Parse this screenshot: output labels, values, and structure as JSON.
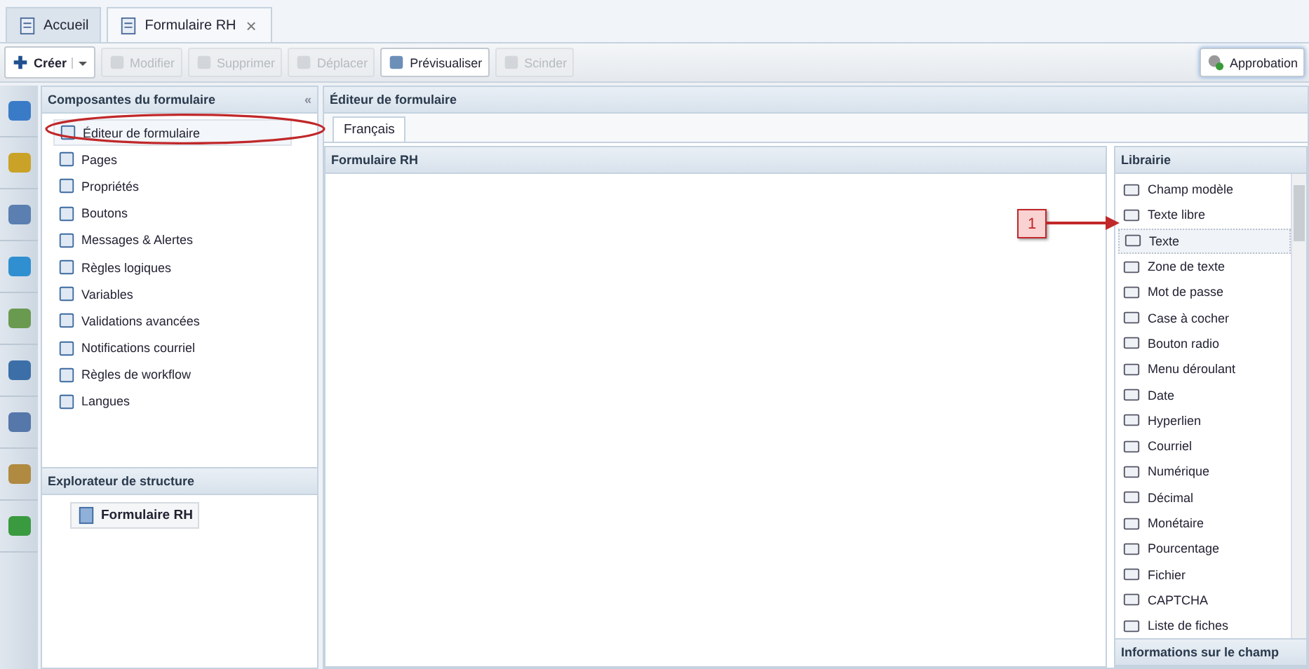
{
  "tabs": [
    {
      "label": "Accueil",
      "selected": false,
      "closable": false
    },
    {
      "label": "Formulaire RH",
      "selected": true,
      "closable": true
    }
  ],
  "close_glyph": "×",
  "toolbar": [
    {
      "label": "Créer",
      "disabled": false,
      "kind": "split"
    },
    {
      "label": "Modifier",
      "disabled": true,
      "kind": "button"
    },
    {
      "label": "Supprimer",
      "disabled": true,
      "kind": "button"
    },
    {
      "label": "Déplacer",
      "disabled": true,
      "kind": "button"
    },
    {
      "label": "Prévisualiser",
      "disabled": false,
      "kind": "button"
    },
    {
      "label": "Scinder",
      "disabled": true,
      "kind": "button"
    }
  ],
  "approval_button": "Approbation",
  "components_panel": {
    "title": "Composantes du formulaire",
    "collapse_glyph": "«",
    "items": [
      {
        "label": "Éditeur de formulaire",
        "selected": true
      },
      {
        "label": "Pages",
        "selected": false
      },
      {
        "label": "Propriétés",
        "selected": false
      },
      {
        "label": "Boutons",
        "selected": false
      },
      {
        "label": "Messages & Alertes",
        "selected": false
      },
      {
        "label": "Règles logiques",
        "selected": false
      },
      {
        "label": "Variables",
        "selected": false
      },
      {
        "label": "Validations avancées",
        "selected": false
      },
      {
        "label": "Notifications courriel",
        "selected": false
      },
      {
        "label": "Règles de workflow",
        "selected": false
      },
      {
        "label": "Langues",
        "selected": false
      }
    ]
  },
  "structure_panel": {
    "title": "Explorateur de structure",
    "items": [
      {
        "label": "Formulaire RH"
      }
    ]
  },
  "editor": {
    "title": "Éditeur de formulaire",
    "language_tabs": [
      {
        "label": "Français",
        "selected": true
      }
    ],
    "form_title": "Formulaire RH"
  },
  "library": {
    "title": "Librairie",
    "items": [
      {
        "label": "Champ modèle",
        "selected": false
      },
      {
        "label": "Texte libre",
        "selected": false
      },
      {
        "label": "Texte",
        "selected": true
      },
      {
        "label": "Zone de texte",
        "selected": false
      },
      {
        "label": "Mot de passe",
        "selected": false
      },
      {
        "label": "Case à cocher",
        "selected": false
      },
      {
        "label": "Bouton radio",
        "selected": false
      },
      {
        "label": "Menu déroulant",
        "selected": false
      },
      {
        "label": "Date",
        "selected": false
      },
      {
        "label": "Hyperlien",
        "selected": false
      },
      {
        "label": "Courriel",
        "selected": false
      },
      {
        "label": "Numérique",
        "selected": false
      },
      {
        "label": "Décimal",
        "selected": false
      },
      {
        "label": "Monétaire",
        "selected": false
      },
      {
        "label": "Pourcentage",
        "selected": false
      },
      {
        "label": "Fichier",
        "selected": false
      },
      {
        "label": "CAPTCHA",
        "selected": false
      },
      {
        "label": "Liste de fiches",
        "selected": false
      }
    ]
  },
  "field_info": {
    "title": "Informations sur le champ"
  },
  "callout": {
    "label": "1"
  }
}
